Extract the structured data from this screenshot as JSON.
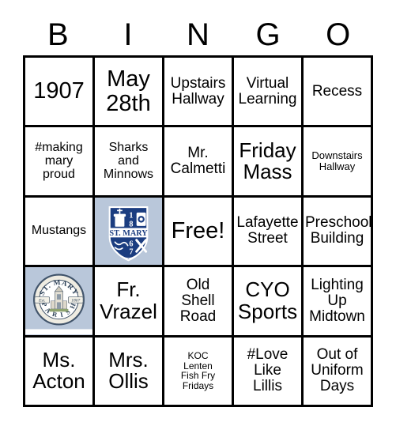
{
  "header": {
    "letters": [
      "B",
      "I",
      "N",
      "G",
      "O"
    ]
  },
  "grid": {
    "rows": [
      [
        {
          "text": "1907",
          "size": "xl",
          "type": "text"
        },
        {
          "text": "May\n28th",
          "size": "xl",
          "type": "text"
        },
        {
          "text": "Upstairs\nHallway",
          "size": "md",
          "type": "text"
        },
        {
          "text": "Virtual\nLearning",
          "size": "md",
          "type": "text"
        },
        {
          "text": "Recess",
          "size": "md",
          "type": "text"
        }
      ],
      [
        {
          "text": "#making\nmary\nproud",
          "size": "sm",
          "type": "text"
        },
        {
          "text": "Sharks\nand\nMinnows",
          "size": "sm",
          "type": "text"
        },
        {
          "text": "Mr.\nCalmetti",
          "size": "md",
          "type": "text"
        },
        {
          "text": "Friday\nMass",
          "size": "lg",
          "type": "text"
        },
        {
          "text": "Downstairs\nHallway",
          "size": "xs",
          "type": "text"
        }
      ],
      [
        {
          "text": "Mustangs",
          "size": "sm",
          "type": "text"
        },
        {
          "text": "",
          "size": "sm",
          "type": "image",
          "image": "st-mary-shield-crest",
          "alt": "St. Mary shield crest 1867"
        },
        {
          "text": "Free!",
          "size": "xl",
          "type": "text"
        },
        {
          "text": "Lafayette\nStreet",
          "size": "md",
          "type": "text"
        },
        {
          "text": "Preschool\nBuilding",
          "size": "md",
          "type": "text"
        }
      ],
      [
        {
          "text": "",
          "size": "sm",
          "type": "image",
          "image": "st-mary-parish-seal",
          "alt": "St. Mary Parish Est. 1867 seal"
        },
        {
          "text": "Fr.\nVrazel",
          "size": "lg",
          "type": "text"
        },
        {
          "text": "Old\nShell\nRoad",
          "size": "md",
          "type": "text"
        },
        {
          "text": "CYO\nSports",
          "size": "lg",
          "type": "text"
        },
        {
          "text": "Lighting\nUp\nMidtown",
          "size": "md",
          "type": "text"
        }
      ],
      [
        {
          "text": "Ms.\nActon",
          "size": "lg",
          "type": "text"
        },
        {
          "text": "Mrs.\nOllis",
          "size": "lg",
          "type": "text"
        },
        {
          "text": "KOC\nLenten\nFish Fry\nFridays",
          "size": "xxs",
          "type": "text"
        },
        {
          "text": "#Love\nLike\nLillis",
          "size": "md",
          "type": "text"
        },
        {
          "text": "Out of\nUniform\nDays",
          "size": "md",
          "type": "text"
        }
      ]
    ]
  },
  "logos": {
    "shield": {
      "navy": "#1b3d80",
      "background": "#b9c7da",
      "banner_text": "ST. MARY",
      "digits": [
        "1",
        "8",
        "6",
        "7"
      ]
    },
    "seal": {
      "background": "#b9c7da",
      "ring": "#41546b",
      "cream": "#efece2",
      "top_text": "ST. MARY",
      "bottom_text": "PARISH",
      "left_text": "Est.",
      "right_text": "1867"
    }
  }
}
